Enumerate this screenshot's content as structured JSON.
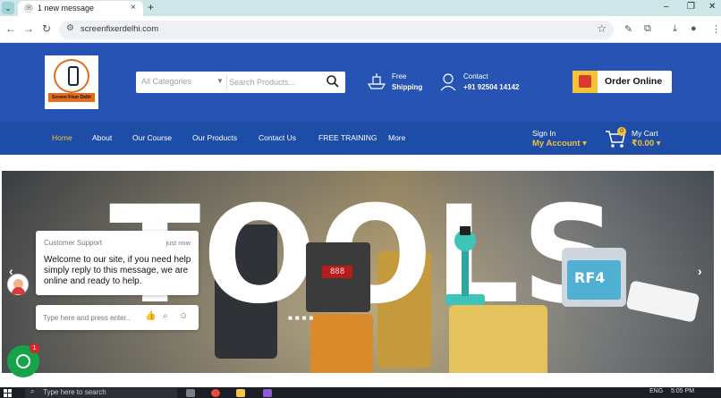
{
  "browser": {
    "tab_title": "1 new message",
    "tab_close": "×",
    "new_tab": "+",
    "url": "screenfixerdelhi.com",
    "window_controls": {
      "minimize": "–",
      "restore": "❐",
      "close": "✕"
    },
    "nav": {
      "back": "←",
      "forward": "→",
      "reload": "↻"
    },
    "star": "☆"
  },
  "header": {
    "logo_text": "Screen Fixer Delhi",
    "search": {
      "category_placeholder": "All Categories",
      "input_placeholder": "Search Products..."
    },
    "shipping": {
      "label": "Free",
      "value": "Shipping"
    },
    "contact": {
      "label": "Contact",
      "value": "+91 92504 14142"
    },
    "order_button": "Order Online"
  },
  "nav": {
    "items": [
      {
        "label": "Home",
        "active": true
      },
      {
        "label": "About"
      },
      {
        "label": "Our Course"
      },
      {
        "label": "Our Products"
      },
      {
        "label": "Contact Us"
      },
      {
        "label": "FREE TRAINING"
      },
      {
        "label": "More"
      }
    ],
    "account": {
      "label": "Sign In",
      "value": "My Account ▾"
    },
    "cart": {
      "label": "My Cart",
      "value": "₹0.00 ▾",
      "count": "0"
    }
  },
  "hero": {
    "text": "TOOLS",
    "station_display": "888",
    "rf4_label": "RF4",
    "prev": "‹",
    "next": "›"
  },
  "chat": {
    "sender": "Customer Support",
    "time": "just now",
    "message": "Welcome to our site, if you need help simply reply to this message, we are online and ready to help.",
    "input_placeholder": "Type here and press enter..",
    "badge": "1"
  },
  "taskbar": {
    "search_placeholder": "Type here to search",
    "language": "ENG",
    "time": "5:05 PM"
  },
  "colors": {
    "header_blue": "#2653b4",
    "nav_blue": "#1e4da8",
    "accent_yellow": "#f3c13a",
    "chat_green": "#16a34a"
  }
}
